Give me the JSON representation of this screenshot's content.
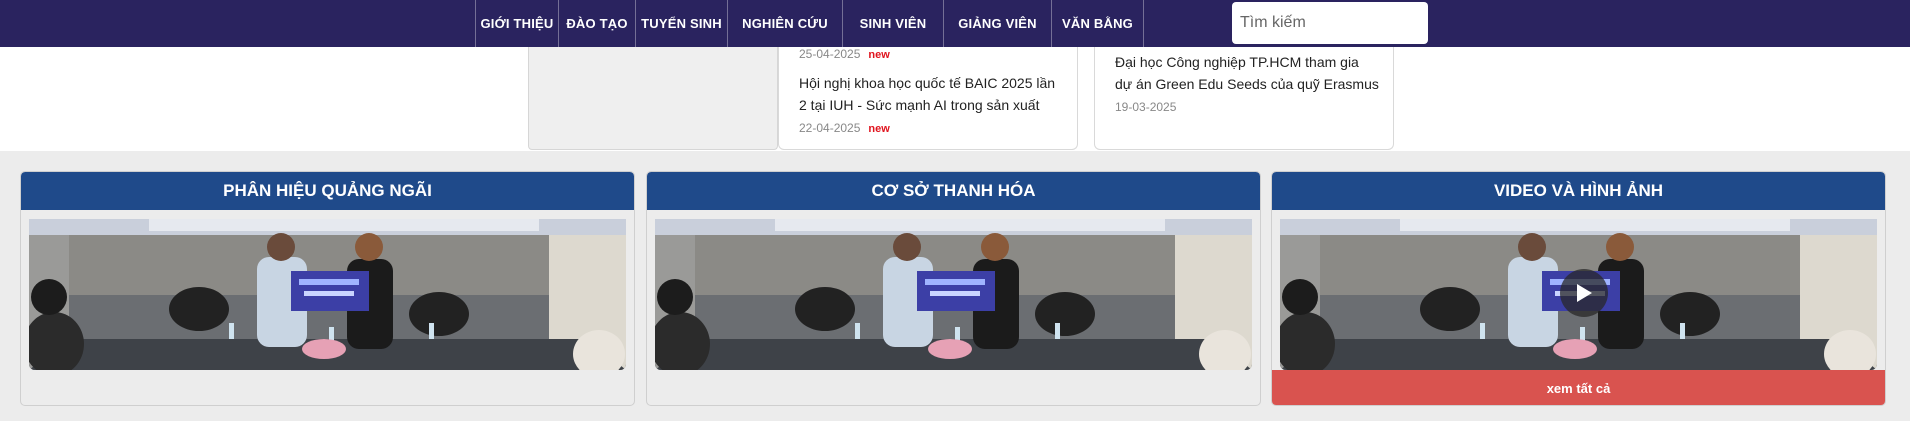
{
  "nav": {
    "items": [
      "Giới thiệu",
      "Đào tạo",
      "Tuyển sinh",
      "Nghiên cứu",
      "Sinh viên",
      "Giảng viên",
      "Văn bằng"
    ],
    "search_placeholder": "Tìm kiếm"
  },
  "news": {
    "mid": [
      {
        "date": "25-04-2025",
        "badge": "new"
      },
      {
        "title_line1": "Hội nghị khoa học quốc tế BAIC 2025 lần",
        "title_line2": "2 tại IUH - Sức mạnh AI trong sản xuất",
        "date": "22-04-2025",
        "badge": "new"
      }
    ],
    "right": {
      "title_line1": "Đại học Công nghiệp TP.HCM tham gia",
      "title_line2": "dự án Green Edu Seeds của quỹ Erasmus",
      "date": "19-03-2025"
    }
  },
  "panels": [
    {
      "title": "PHÂN HIỆU QUẢNG NGÃI"
    },
    {
      "title": "CƠ SỞ THANH HÓA"
    },
    {
      "title": "VIDEO VÀ HÌNH ẢNH",
      "footer": "xem tất cả"
    }
  ],
  "colors": {
    "nav_bg": "#2a235f",
    "panel_header": "#1f4a8a",
    "see_all": "#d9534f",
    "new_badge": "#e0141e"
  }
}
